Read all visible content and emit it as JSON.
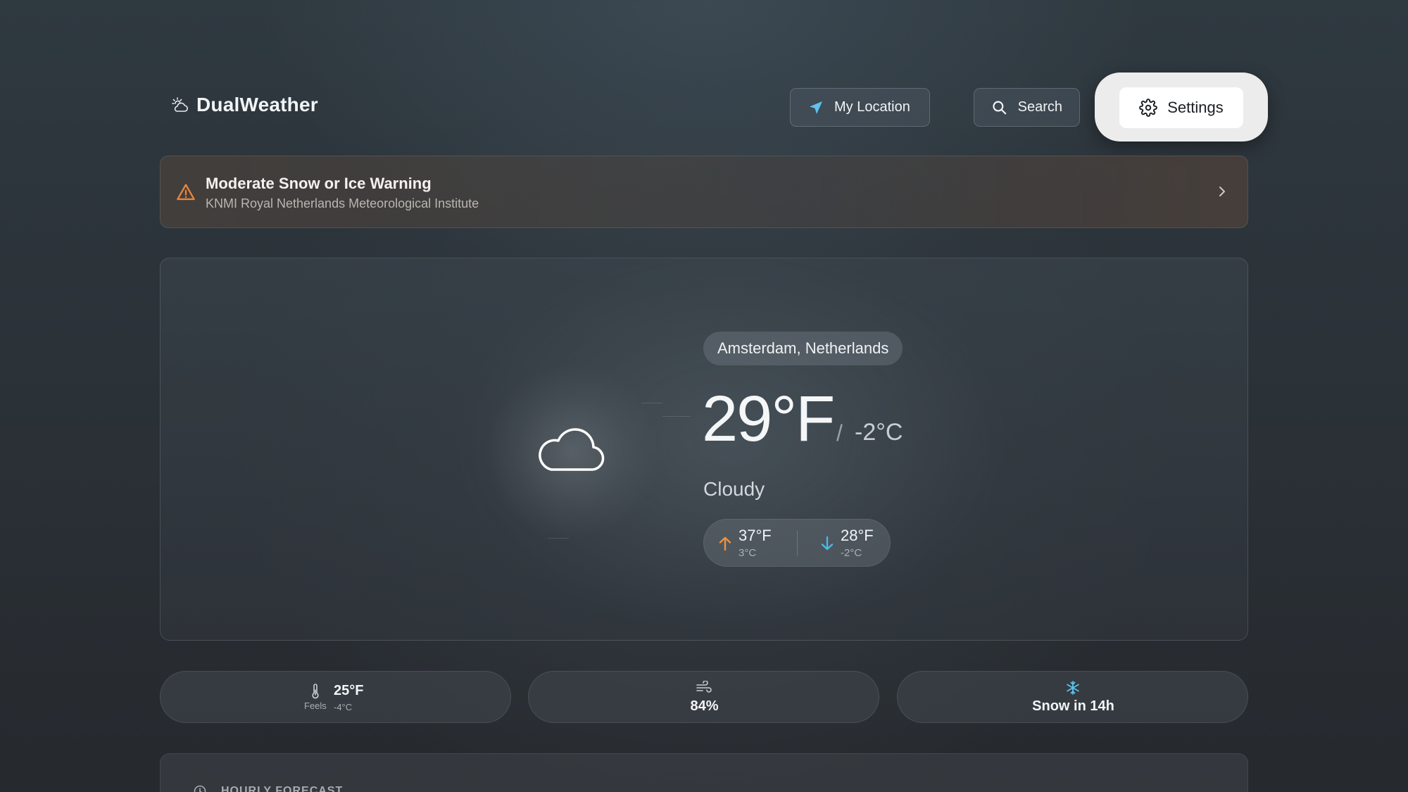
{
  "app": {
    "name": "DualWeather"
  },
  "header": {
    "location_label": "My Location",
    "search_label": "Search",
    "settings_label": "Settings"
  },
  "alert": {
    "title": "Moderate Snow or Ice Warning",
    "source": "KNMI Royal Netherlands Meteorological Institute"
  },
  "current": {
    "location": "Amsterdam, Netherlands",
    "temp_f": "29°F",
    "separator": "/",
    "temp_c": "-2°C",
    "condition": "Cloudy",
    "high_f": "37°F",
    "high_c": "3°C",
    "low_f": "28°F",
    "low_c": "-2°C"
  },
  "stats": {
    "feels_label": "Feels",
    "feels_f": "25°F",
    "feels_c": "-4°C",
    "humidity": "84%",
    "snow": "Snow in 14h"
  },
  "hourly": {
    "label": "HOURLY FORECAST"
  },
  "colors": {
    "warning": "#e8853c",
    "high_arrow": "#f0913e",
    "low_arrow": "#4bb8e6",
    "location_icon": "#5ec3ee",
    "snow_icon": "#5ec3ee"
  },
  "icons": {
    "logo": "cloud-sun-icon",
    "location": "navigation-arrow-icon",
    "search": "search-icon",
    "settings": "gear-icon",
    "warning": "warning-triangle-icon",
    "chevron": "chevron-right-icon",
    "weather": "cloud-icon",
    "feels": "thermometer-icon",
    "humidity": "wind-icon",
    "snow": "snowflake-icon",
    "hourly": "clock-icon"
  }
}
